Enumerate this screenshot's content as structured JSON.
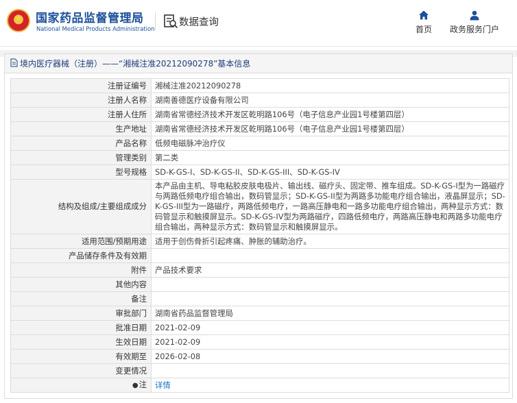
{
  "header": {
    "brand_cn": "国家药品监督管理局",
    "brand_en": "National Medical Products Administration",
    "query_label": "数据查询",
    "nav_home": "首页",
    "nav_gov": "政务服务门户"
  },
  "breadcrumb": {
    "text": "境内医疗器械（注册）——“湘械注准20212090278”基本信息"
  },
  "rows": [
    {
      "label": "注册证编号",
      "value": "湘械注准20212090278"
    },
    {
      "label": "注册人名称",
      "value": "湖南善德医疗设备有限公司"
    },
    {
      "label": "注册人住所",
      "value": "湖南省常德经济技术开发区乾明路106号（电子信息产业园1号楼第四层）"
    },
    {
      "label": "生产地址",
      "value": "湖南省常德经济技术开发区乾明路106号（电子信息产业园1号楼第四层）"
    },
    {
      "label": "产品名称",
      "value": "低频电磁脉冲治疗仪"
    },
    {
      "label": "管理类别",
      "value": "第二类"
    },
    {
      "label": "型号规格",
      "value": "SD-K-GS-I、SD-K-GS-II、SD-K-GS-III、SD-K-GS-IV"
    },
    {
      "label": "结构及组成/主要组成成分",
      "value": "本产品由主机、导电粘胶皮肤电极片、输出线、磁疗头、固定带、推车组成。SD-K-GS-I型为一路磁疗与两路低频电疗组合输出，数码管显示；SD-K-GS-II型为两路多功能电疗组合输出，液晶屏显示；SD-K-GS-III型为一路磁疗，两路低频电疗，一路高压静电和一路多功能电疗组合输出，两种显示方式：数码管显示和触摸屏显示。SD-K-GS-IV型为两路磁疗，四路低频电疗，两路高压静电和两路多功能电疗组合输出，两种显示方式：数码管显示和触摸屏显示。"
    },
    {
      "label": "适用范围/预期用途",
      "value": "适用于创伤骨折引起疼痛、肿胀的辅助治疗。"
    },
    {
      "label": "产品储存条件及有效期",
      "value": ""
    },
    {
      "label": "附件",
      "value": "产品技术要求"
    },
    {
      "label": "其他内容",
      "value": ""
    },
    {
      "label": "备注",
      "value": ""
    },
    {
      "label": "审批部门",
      "value": "湖南省药品监督管理局"
    },
    {
      "label": "批准日期",
      "value": "2021-02-09"
    },
    {
      "label": "生效日期",
      "value": "2021-02-09"
    },
    {
      "label": "有效期至",
      "value": "2026-02-08"
    },
    {
      "label": "变更情况",
      "value": ""
    },
    {
      "label": "注",
      "value": "详情"
    }
  ],
  "colors": {
    "brand_blue": "#1c4f9c",
    "link_blue": "#1a6fc2",
    "label_bg": "#f3f3f3"
  }
}
